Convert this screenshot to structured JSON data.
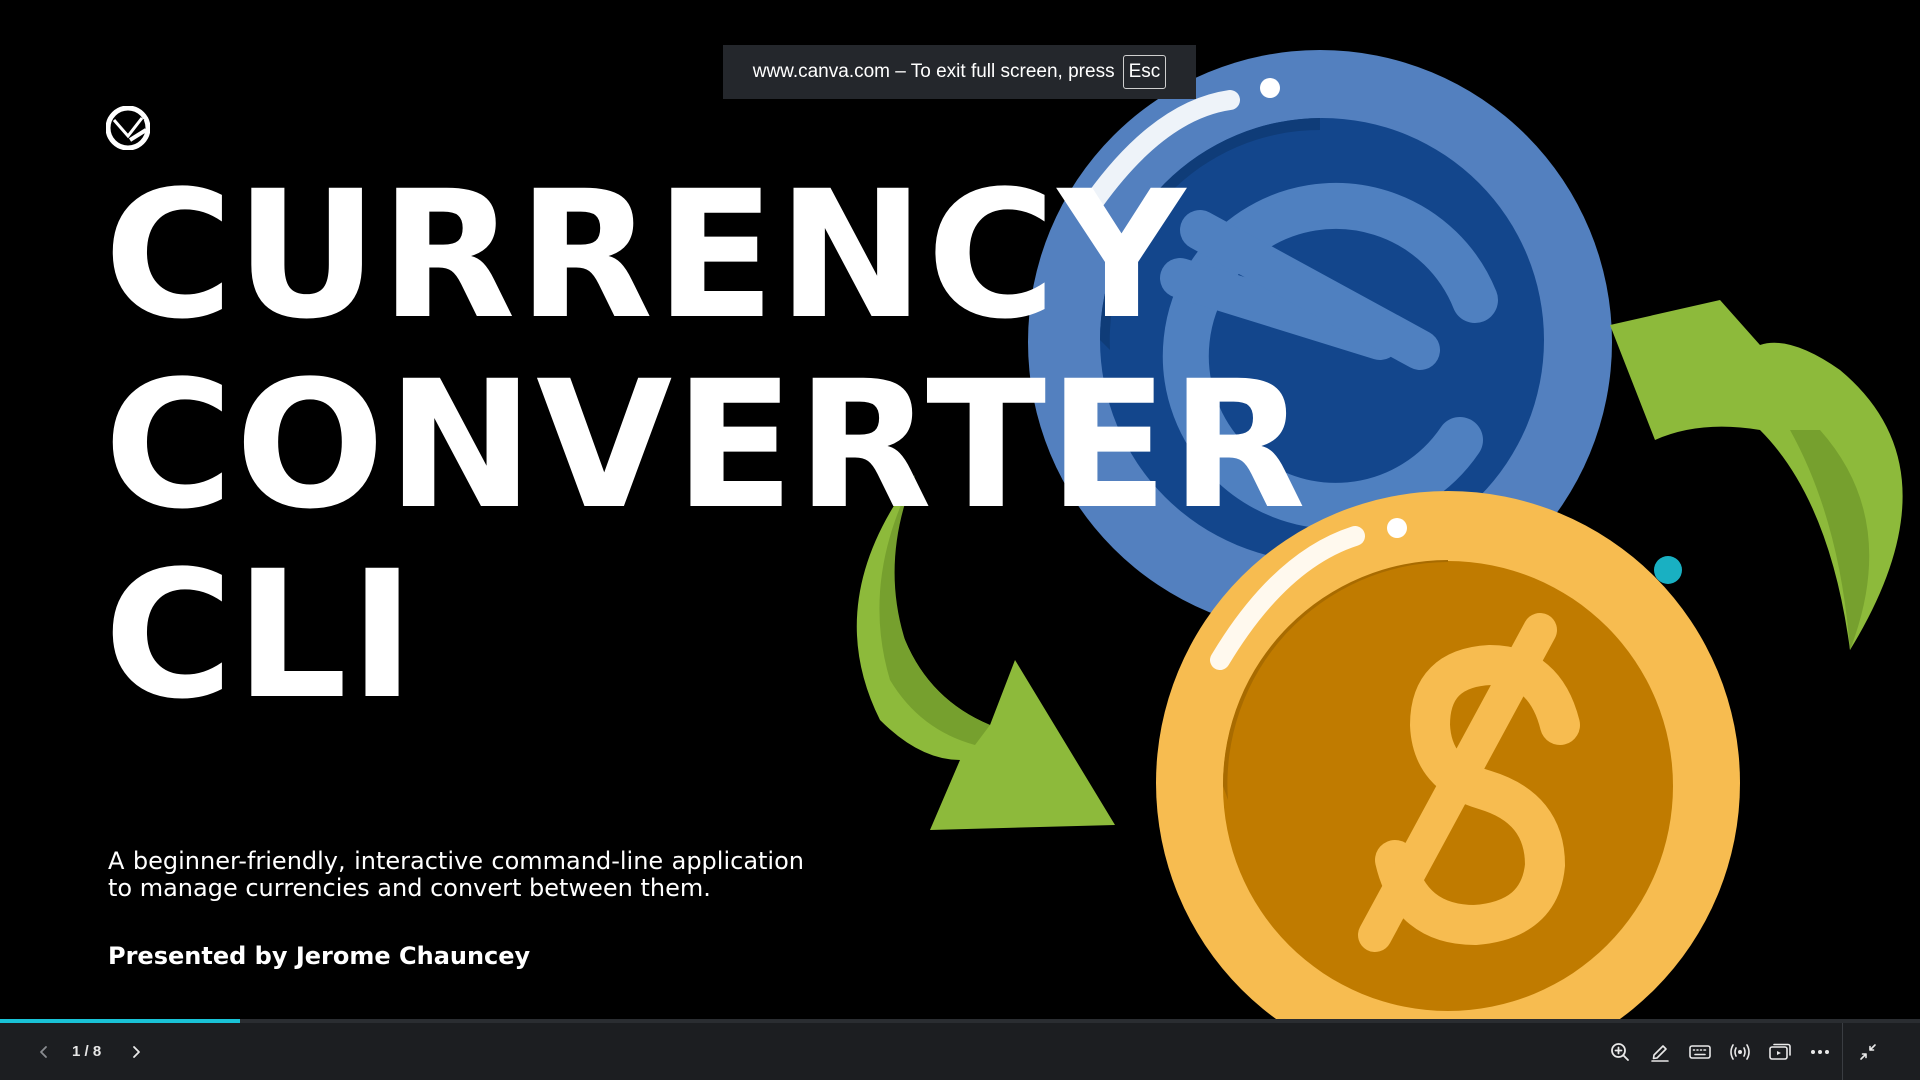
{
  "fullscreen_notice": {
    "text": "www.canva.com – To exit full screen, press",
    "key": "Esc"
  },
  "slide": {
    "title_lines": [
      "CURRENCY",
      "CONVERTER",
      "CLI"
    ],
    "subtitle": "A beginner-friendly, interactive command-line application to manage currencies and convert between them.",
    "presenter": "Presented by Jerome Chauncey"
  },
  "controls": {
    "page_indicator": "1 / 8",
    "progress_fraction": 0.125,
    "icons": [
      "chevron-left-icon",
      "chevron-right-icon",
      "zoom-icon",
      "pen-icon",
      "keyboard-icon",
      "broadcast-icon",
      "present-icon",
      "more-icon",
      "exit-fullscreen-icon"
    ]
  },
  "colors": {
    "accent": "#19c2d6",
    "coin_blue": "#5380bf",
    "coin_blue_inner": "#13468c",
    "coin_gold": "#f7bc50",
    "coin_gold_inner": "#c07b00",
    "arrow_green": "#8dba3b",
    "bar_bg": "#1c1e21"
  }
}
